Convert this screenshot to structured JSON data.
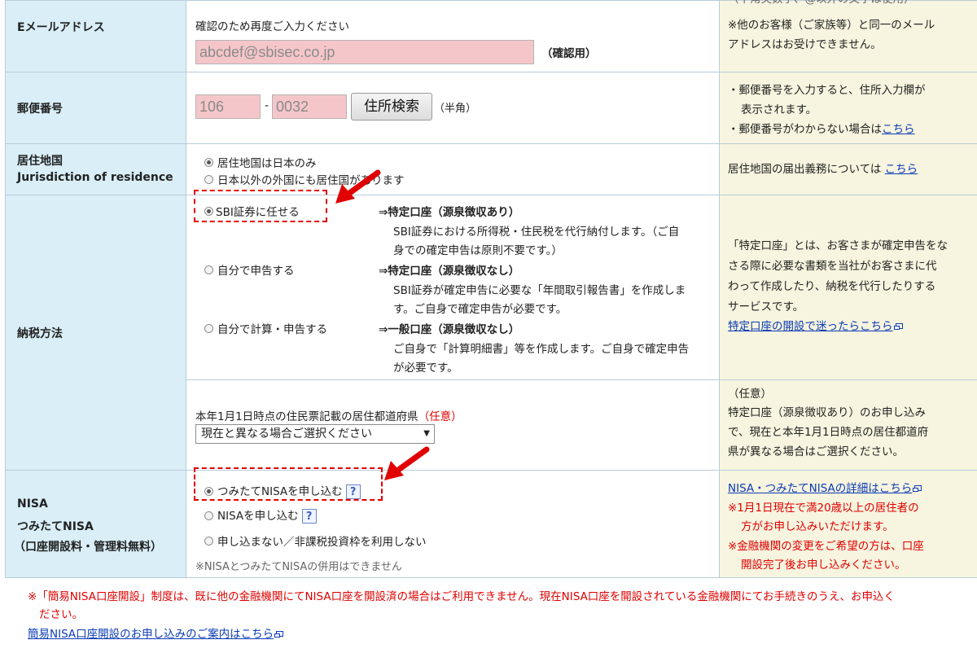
{
  "email": {
    "label": "Eメールアドレス",
    "hint": "確認のため再度ご入力ください",
    "value": "abcdef@sbisec.co.jp",
    "confirm_suffix": "（確認用）",
    "note_top": "（半角英数字、@以外の文字は使用）",
    "note_l1": "※他のお客様（ご家族等）と同一のメール",
    "note_l2": "アドレスはお受けできません。"
  },
  "postal": {
    "label": "郵便番号",
    "part1": "106",
    "part2": "0032",
    "dash": "-",
    "search_button": "住所検索",
    "half_width": "（半角）",
    "note_l1": "・郵便番号を入力すると、住所入力欄が",
    "note_l2": "表示されます。",
    "note_l3_prefix": "・郵便番号がわからない場合は",
    "note_l3_link": "こちら"
  },
  "residence": {
    "label_ja": "居住地国",
    "label_en": "Jurisdiction of residence",
    "option1": "居住地国は日本のみ",
    "option2": "日本以外の外国にも居住国があります",
    "note_prefix": "居住地国の届出義務については",
    "note_link": "こちら"
  },
  "tax": {
    "label": "納税方法",
    "options": [
      {
        "label": "SBI証券に任せる",
        "result": "⇒特定口座（源泉徴収あり）",
        "desc1": "SBI証券における所得税・住民税を代行納付します。（ご自",
        "desc2": "身での確定申告は原則不要です。）"
      },
      {
        "label": "自分で申告する",
        "result": "⇒特定口座（源泉徴収なし）",
        "desc1": "SBI証券が確定申告に必要な「年間取引報告書」を作成しま",
        "desc2": "す。ご自身で確定申告が必要です。"
      },
      {
        "label": "自分で計算・申告する",
        "result": "⇒一般口座（源泉徴収なし）",
        "desc1": "ご自身で「計算明細書」等を作成します。ご自身で確定申告",
        "desc2": "が必要です。"
      }
    ],
    "note_l1": "「特定口座」とは、お客さまが確定申告をな",
    "note_l2": "さる際に必要な書類を当社がお客さまに代",
    "note_l3": "わって作成したり、納税を代行したりする",
    "note_l4": "サービスです。",
    "note_link": "特定口座の開設で迷ったらこちら",
    "pref_label": "本年1月1日時点の住民票記載の居住都道府県",
    "pref_optional": "（任意）",
    "pref_select": "現在と異なる場合ご選択ください",
    "pref_note_l1": "（任意）",
    "pref_note_l2": "特定口座（源泉徴収あり）のお申し込み",
    "pref_note_l3": "で、現在と本年1月1日時点の居住都道府",
    "pref_note_l4": "県が異なる場合はご選択ください。"
  },
  "nisa": {
    "label_l1": "NISA",
    "label_l2": "つみたてNISA",
    "label_l3": "（口座開設料・管理料無料）",
    "option1": "つみたてNISAを申し込む",
    "option2": "NISAを申し込む",
    "option3": "申し込まない／非課税投資枠を利用しない",
    "help": "?",
    "caution": "※NISAとつみたてNISAの併用はできません",
    "note_link": "NISA・つみたてNISAの詳細はこちら",
    "note_r1": "※1月1日現在で満20歳以上の居住者の",
    "note_r2": "方がお申し込みいただけます。",
    "note_r3": "※金融機関の変更をご希望の方は、口座",
    "note_r4": "開設完了後お申し込みください。"
  },
  "footer": {
    "line1": "※「簡易NISA口座開設」制度は、既に他の金融機関にてNISA口座を開設済の場合はご利用できません。現在NISA口座を開設されている金融機関にてお手続きのうえ、お申込く",
    "line2": "ださい。",
    "link": "簡易NISA口座開設のお申し込みのご案内はこちら"
  },
  "colors": {
    "annotation": "#e00000",
    "label_bg": "#d9eef7",
    "note_bg": "#f7f4df",
    "link": "#0a3bb5"
  }
}
